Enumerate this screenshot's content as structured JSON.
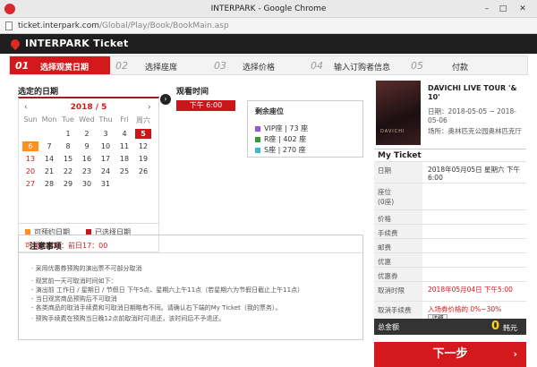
{
  "window": {
    "title": "INTERPARK - Google Chrome",
    "controls": {
      "minimize": "–",
      "maximize": "□",
      "close": "✕"
    }
  },
  "address": {
    "domain": "ticket.interpark.com",
    "path": "/Global/Play/Book/BookMain.asp"
  },
  "header": {
    "brand": "INTERPARK Ticket"
  },
  "steps": [
    {
      "num": "01",
      "label": "选择观赏日期",
      "active": true
    },
    {
      "num": "02",
      "label": "选择座席"
    },
    {
      "num": "03",
      "label": "选择价格"
    },
    {
      "num": "04",
      "label": "输入订购者信息"
    },
    {
      "num": "05",
      "label": "付款"
    }
  ],
  "date_panel": {
    "label": "选定的日期",
    "prev": "‹",
    "next": "›",
    "month": "2018 / 5",
    "weekdays": [
      "Sun",
      "Mon",
      "Tue",
      "Wed",
      "Thu",
      "Fri",
      "周六"
    ],
    "days": [
      "",
      "",
      "1",
      "2",
      "3",
      "4",
      "5",
      "6",
      "7",
      "8",
      "9",
      "10",
      "11",
      "12",
      "13",
      "14",
      "15",
      "16",
      "17",
      "18",
      "19",
      "20",
      "21",
      "22",
      "23",
      "24",
      "25",
      "26",
      "27",
      "28",
      "29",
      "30",
      "31",
      "",
      ""
    ],
    "available_day": "6",
    "selected_day": "5",
    "legend_available": "可预约日期",
    "legend_selected": "已选择日期",
    "deadline": "可预约时间：前日17：00",
    "colors": {
      "available": "#ff8f1f",
      "selected": "#c9161b"
    }
  },
  "time_panel": {
    "label": "观看时间",
    "selected": "下午 6:00"
  },
  "seats": {
    "header": "剩余座位",
    "rows": [
      {
        "text": "VIP座 | 73 座",
        "color": "#8e5bd6"
      },
      {
        "text": "R座 | 402 座",
        "color": "#2f9a3a"
      },
      {
        "text": "S座 | 270 座",
        "color": "#3ab8d8"
      }
    ]
  },
  "notice": {
    "title": "注意事项",
    "lines": [
      "· 采用优惠券预购的演出票不可部分取消",
      "· 观赏前一天可取消时间如下：",
      "  - 演出前 工作日 / 星期日 / 节假日 下午5点、星期六上午11点（若星期六为节假日截止上午11点）",
      "  - 当日观赏商品预购后不可取消",
      "  - 各类商品的取消手续费和可取消日期略有不同。请确认右下端的My Ticket（我的票务）。",
      "· 预购手续费在预购当日晚12点前取消时可退还，该时间后不予退还。"
    ]
  },
  "summary": {
    "poster_text": "DAVICHI",
    "show_title": "DAVICHI LIVE TOUR '& 10'",
    "date_label": "日期：",
    "date_value": "2018-05-05 ~ 2018-05-06",
    "venue_label": "场所：",
    "venue_value": "奥林匹克公园奥林匹克厅",
    "my_ticket": "My Ticket",
    "rows": [
      {
        "key": "日期",
        "value": "2018年05月05日 星期六 下午 6:00"
      },
      {
        "key": "座位\n(0座)",
        "value": ""
      },
      {
        "key": "价格",
        "value": ""
      },
      {
        "key": "手续费",
        "value": ""
      },
      {
        "key": "邮费",
        "value": ""
      },
      {
        "key": "优惠",
        "value": ""
      },
      {
        "key": "优惠券",
        "value": ""
      },
      {
        "key": "取消时限",
        "value": "2018年05月04日 下午5:00"
      },
      {
        "key": "取消手续费",
        "value": "入场券价格的 0%~30%"
      }
    ],
    "detail_button": "详细",
    "total_label": "总金额",
    "total_amount": "0",
    "total_unit": "韩元"
  },
  "next_button": {
    "label": "下一步",
    "chevron": "›"
  }
}
